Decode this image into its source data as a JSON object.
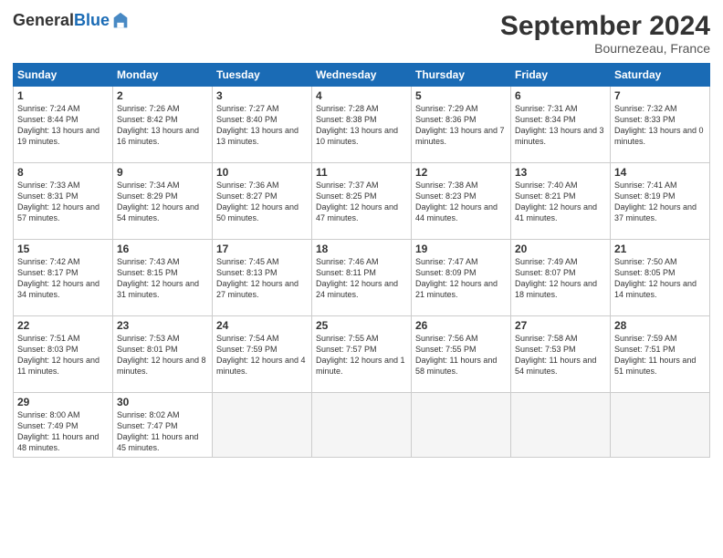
{
  "header": {
    "logo_general": "General",
    "logo_blue": "Blue",
    "month_title": "September 2024",
    "location": "Bournezeau, France"
  },
  "weekdays": [
    "Sunday",
    "Monday",
    "Tuesday",
    "Wednesday",
    "Thursday",
    "Friday",
    "Saturday"
  ],
  "weeks": [
    [
      {
        "day": "1",
        "sunrise": "Sunrise: 7:24 AM",
        "sunset": "Sunset: 8:44 PM",
        "daylight": "Daylight: 13 hours and 19 minutes."
      },
      {
        "day": "2",
        "sunrise": "Sunrise: 7:26 AM",
        "sunset": "Sunset: 8:42 PM",
        "daylight": "Daylight: 13 hours and 16 minutes."
      },
      {
        "day": "3",
        "sunrise": "Sunrise: 7:27 AM",
        "sunset": "Sunset: 8:40 PM",
        "daylight": "Daylight: 13 hours and 13 minutes."
      },
      {
        "day": "4",
        "sunrise": "Sunrise: 7:28 AM",
        "sunset": "Sunset: 8:38 PM",
        "daylight": "Daylight: 13 hours and 10 minutes."
      },
      {
        "day": "5",
        "sunrise": "Sunrise: 7:29 AM",
        "sunset": "Sunset: 8:36 PM",
        "daylight": "Daylight: 13 hours and 7 minutes."
      },
      {
        "day": "6",
        "sunrise": "Sunrise: 7:31 AM",
        "sunset": "Sunset: 8:34 PM",
        "daylight": "Daylight: 13 hours and 3 minutes."
      },
      {
        "day": "7",
        "sunrise": "Sunrise: 7:32 AM",
        "sunset": "Sunset: 8:33 PM",
        "daylight": "Daylight: 13 hours and 0 minutes."
      }
    ],
    [
      {
        "day": "8",
        "sunrise": "Sunrise: 7:33 AM",
        "sunset": "Sunset: 8:31 PM",
        "daylight": "Daylight: 12 hours and 57 minutes."
      },
      {
        "day": "9",
        "sunrise": "Sunrise: 7:34 AM",
        "sunset": "Sunset: 8:29 PM",
        "daylight": "Daylight: 12 hours and 54 minutes."
      },
      {
        "day": "10",
        "sunrise": "Sunrise: 7:36 AM",
        "sunset": "Sunset: 8:27 PM",
        "daylight": "Daylight: 12 hours and 50 minutes."
      },
      {
        "day": "11",
        "sunrise": "Sunrise: 7:37 AM",
        "sunset": "Sunset: 8:25 PM",
        "daylight": "Daylight: 12 hours and 47 minutes."
      },
      {
        "day": "12",
        "sunrise": "Sunrise: 7:38 AM",
        "sunset": "Sunset: 8:23 PM",
        "daylight": "Daylight: 12 hours and 44 minutes."
      },
      {
        "day": "13",
        "sunrise": "Sunrise: 7:40 AM",
        "sunset": "Sunset: 8:21 PM",
        "daylight": "Daylight: 12 hours and 41 minutes."
      },
      {
        "day": "14",
        "sunrise": "Sunrise: 7:41 AM",
        "sunset": "Sunset: 8:19 PM",
        "daylight": "Daylight: 12 hours and 37 minutes."
      }
    ],
    [
      {
        "day": "15",
        "sunrise": "Sunrise: 7:42 AM",
        "sunset": "Sunset: 8:17 PM",
        "daylight": "Daylight: 12 hours and 34 minutes."
      },
      {
        "day": "16",
        "sunrise": "Sunrise: 7:43 AM",
        "sunset": "Sunset: 8:15 PM",
        "daylight": "Daylight: 12 hours and 31 minutes."
      },
      {
        "day": "17",
        "sunrise": "Sunrise: 7:45 AM",
        "sunset": "Sunset: 8:13 PM",
        "daylight": "Daylight: 12 hours and 27 minutes."
      },
      {
        "day": "18",
        "sunrise": "Sunrise: 7:46 AM",
        "sunset": "Sunset: 8:11 PM",
        "daylight": "Daylight: 12 hours and 24 minutes."
      },
      {
        "day": "19",
        "sunrise": "Sunrise: 7:47 AM",
        "sunset": "Sunset: 8:09 PM",
        "daylight": "Daylight: 12 hours and 21 minutes."
      },
      {
        "day": "20",
        "sunrise": "Sunrise: 7:49 AM",
        "sunset": "Sunset: 8:07 PM",
        "daylight": "Daylight: 12 hours and 18 minutes."
      },
      {
        "day": "21",
        "sunrise": "Sunrise: 7:50 AM",
        "sunset": "Sunset: 8:05 PM",
        "daylight": "Daylight: 12 hours and 14 minutes."
      }
    ],
    [
      {
        "day": "22",
        "sunrise": "Sunrise: 7:51 AM",
        "sunset": "Sunset: 8:03 PM",
        "daylight": "Daylight: 12 hours and 11 minutes."
      },
      {
        "day": "23",
        "sunrise": "Sunrise: 7:53 AM",
        "sunset": "Sunset: 8:01 PM",
        "daylight": "Daylight: 12 hours and 8 minutes."
      },
      {
        "day": "24",
        "sunrise": "Sunrise: 7:54 AM",
        "sunset": "Sunset: 7:59 PM",
        "daylight": "Daylight: 12 hours and 4 minutes."
      },
      {
        "day": "25",
        "sunrise": "Sunrise: 7:55 AM",
        "sunset": "Sunset: 7:57 PM",
        "daylight": "Daylight: 12 hours and 1 minute."
      },
      {
        "day": "26",
        "sunrise": "Sunrise: 7:56 AM",
        "sunset": "Sunset: 7:55 PM",
        "daylight": "Daylight: 11 hours and 58 minutes."
      },
      {
        "day": "27",
        "sunrise": "Sunrise: 7:58 AM",
        "sunset": "Sunset: 7:53 PM",
        "daylight": "Daylight: 11 hours and 54 minutes."
      },
      {
        "day": "28",
        "sunrise": "Sunrise: 7:59 AM",
        "sunset": "Sunset: 7:51 PM",
        "daylight": "Daylight: 11 hours and 51 minutes."
      }
    ],
    [
      {
        "day": "29",
        "sunrise": "Sunrise: 8:00 AM",
        "sunset": "Sunset: 7:49 PM",
        "daylight": "Daylight: 11 hours and 48 minutes."
      },
      {
        "day": "30",
        "sunrise": "Sunrise: 8:02 AM",
        "sunset": "Sunset: 7:47 PM",
        "daylight": "Daylight: 11 hours and 45 minutes."
      },
      null,
      null,
      null,
      null,
      null
    ]
  ]
}
